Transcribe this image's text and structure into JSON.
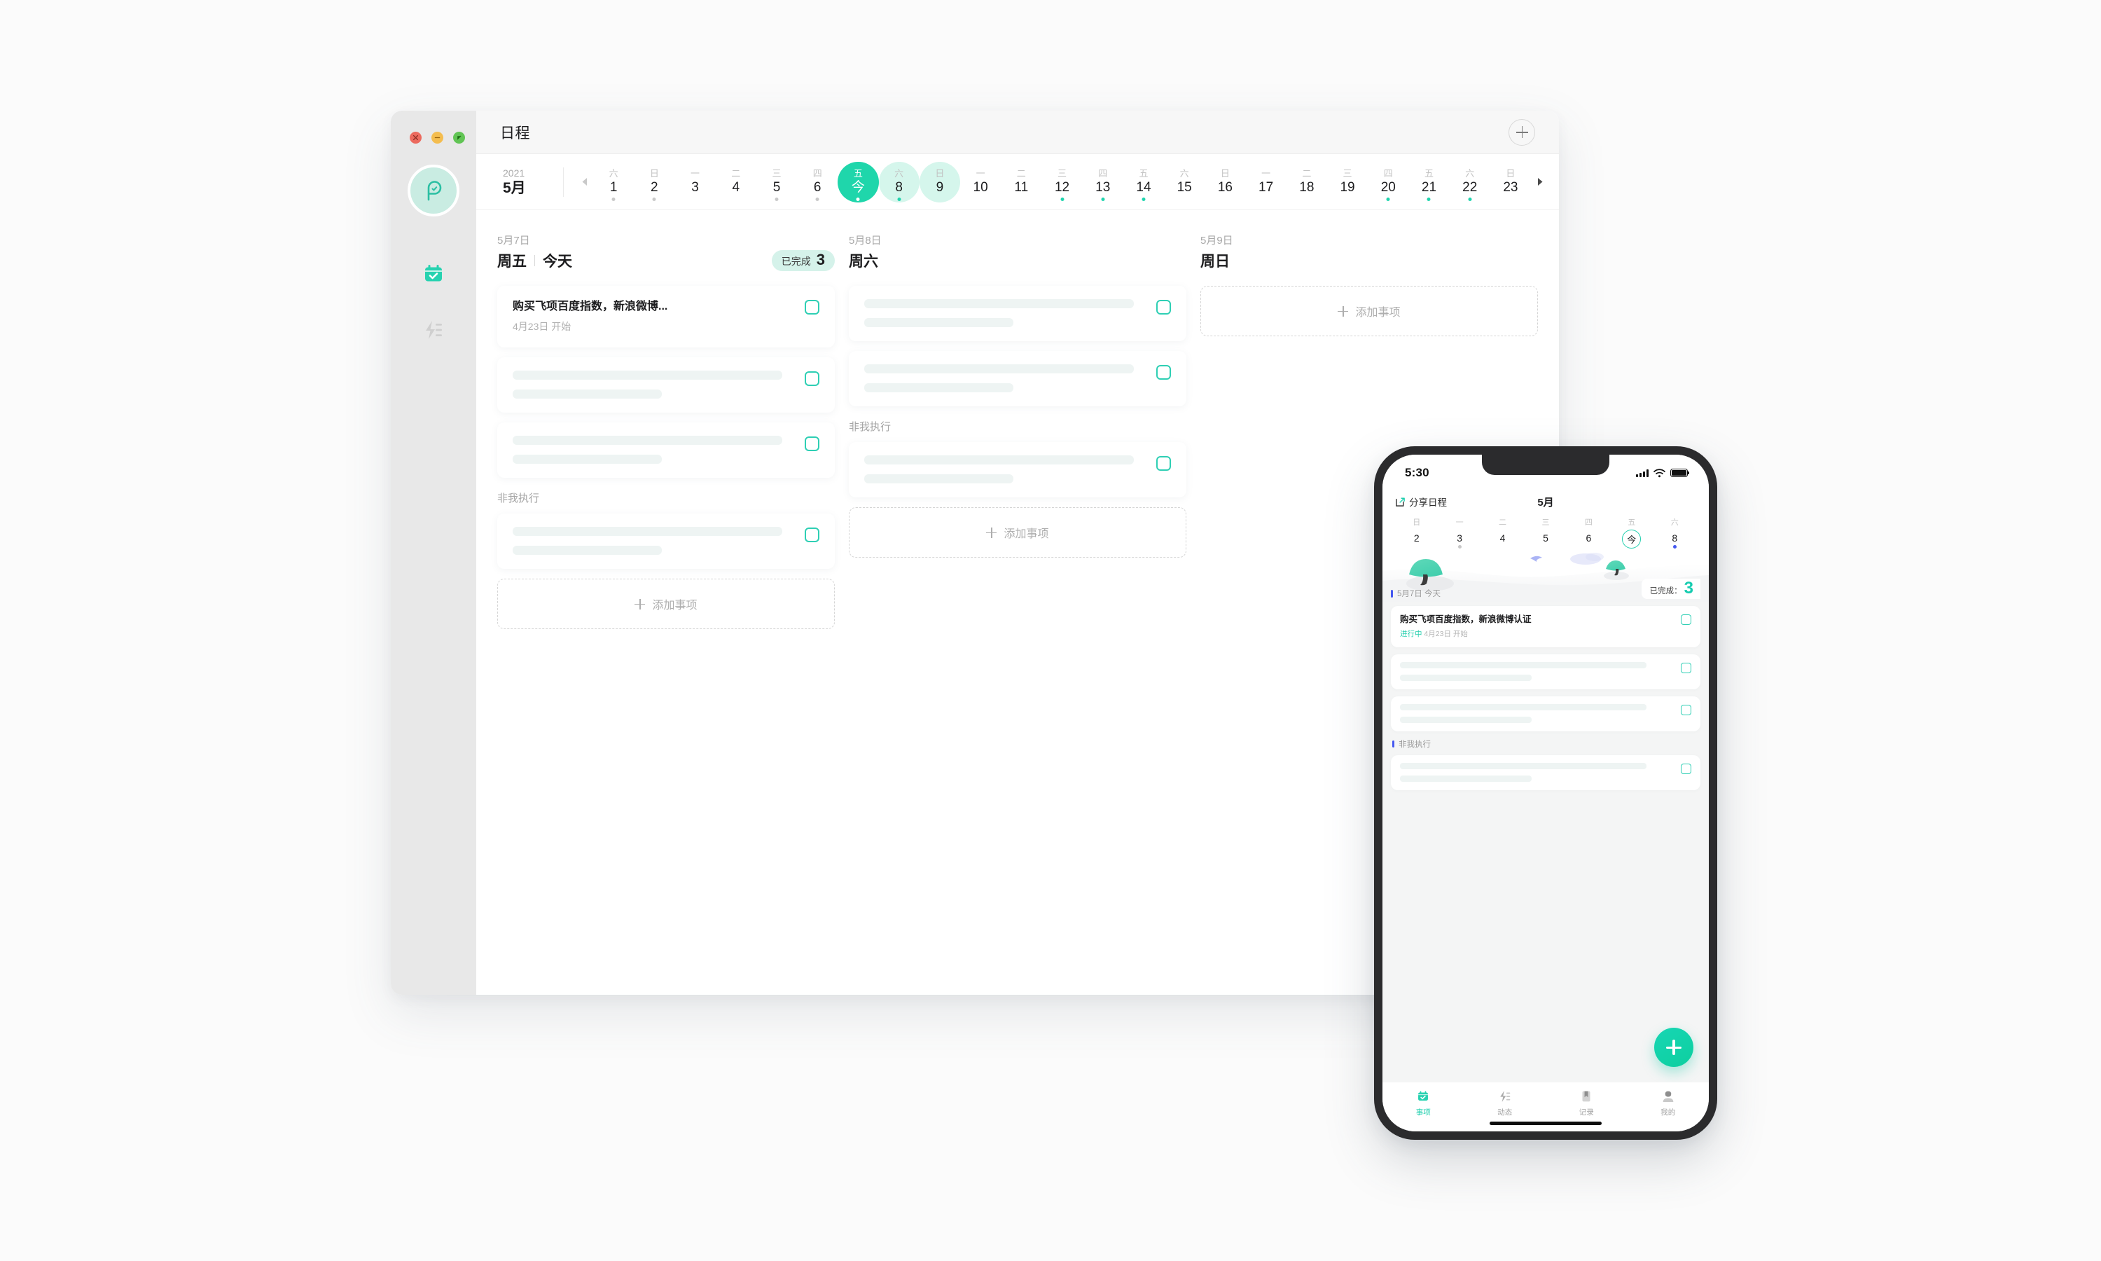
{
  "desktop": {
    "window_title": "日程",
    "titlebar": {
      "add_button_icon": "plus-circle-icon"
    },
    "traffic_lights": [
      "close",
      "minimize",
      "maximize"
    ],
    "sidebar": {
      "avatar_icon": "app-logo-icon",
      "items": [
        {
          "name": "schedule",
          "icon": "calendar-check-icon",
          "active": true
        },
        {
          "name": "activity",
          "icon": "activity-lightning-icon",
          "active": false
        }
      ]
    },
    "datestrip": {
      "year": "2021",
      "month": "5月",
      "prev_icon": "chevron-left-icon",
      "next_icon": "chevron-right-icon",
      "days": [
        {
          "weekday": "六",
          "num": "1",
          "dot": "grey",
          "state": "normal"
        },
        {
          "weekday": "日",
          "num": "2",
          "dot": "grey",
          "state": "normal"
        },
        {
          "weekday": "一",
          "num": "3",
          "dot": "none",
          "state": "normal"
        },
        {
          "weekday": "二",
          "num": "4",
          "dot": "none",
          "state": "normal"
        },
        {
          "weekday": "三",
          "num": "5",
          "dot": "grey",
          "state": "normal"
        },
        {
          "weekday": "四",
          "num": "6",
          "dot": "grey",
          "state": "normal"
        },
        {
          "weekday": "五",
          "num": "今",
          "dot": "white",
          "state": "today"
        },
        {
          "weekday": "六",
          "num": "8",
          "dot": "teal",
          "state": "highlight"
        },
        {
          "weekday": "日",
          "num": "9",
          "dot": "none",
          "state": "highlight"
        },
        {
          "weekday": "一",
          "num": "10",
          "dot": "none",
          "state": "normal"
        },
        {
          "weekday": "二",
          "num": "11",
          "dot": "none",
          "state": "normal"
        },
        {
          "weekday": "三",
          "num": "12",
          "dot": "teal",
          "state": "normal"
        },
        {
          "weekday": "四",
          "num": "13",
          "dot": "teal",
          "state": "normal"
        },
        {
          "weekday": "五",
          "num": "14",
          "dot": "teal",
          "state": "normal"
        },
        {
          "weekday": "六",
          "num": "15",
          "dot": "none",
          "state": "normal"
        },
        {
          "weekday": "日",
          "num": "16",
          "dot": "none",
          "state": "normal"
        },
        {
          "weekday": "一",
          "num": "17",
          "dot": "none",
          "state": "normal"
        },
        {
          "weekday": "二",
          "num": "18",
          "dot": "none",
          "state": "normal"
        },
        {
          "weekday": "三",
          "num": "19",
          "dot": "none",
          "state": "normal"
        },
        {
          "weekday": "四",
          "num": "20",
          "dot": "teal",
          "state": "normal"
        },
        {
          "weekday": "五",
          "num": "21",
          "dot": "teal",
          "state": "normal"
        },
        {
          "weekday": "六",
          "num": "22",
          "dot": "teal",
          "state": "normal"
        },
        {
          "weekday": "日",
          "num": "23",
          "dot": "none",
          "state": "normal"
        }
      ]
    },
    "columns": [
      {
        "date": "5月7日",
        "weekday": "周五",
        "today_label": "今天",
        "done_label": "已完成",
        "done_count": "3",
        "tasks": [
          {
            "kind": "text",
            "title": "购买飞项百度指数，新浪微博...",
            "sub": "4月23日 开始"
          },
          {
            "kind": "skeleton"
          },
          {
            "kind": "skeleton"
          }
        ],
        "section_label": "非我执行",
        "section_tasks": [
          {
            "kind": "skeleton"
          }
        ],
        "add_label": "添加事项"
      },
      {
        "date": "5月8日",
        "weekday": "周六",
        "tasks": [
          {
            "kind": "skeleton"
          },
          {
            "kind": "skeleton"
          }
        ],
        "section_label": "非我执行",
        "section_tasks": [
          {
            "kind": "skeleton"
          }
        ],
        "add_label": "添加事项"
      },
      {
        "date": "5月9日",
        "weekday": "周日",
        "tasks": [],
        "add_label": "添加事项"
      }
    ]
  },
  "phone": {
    "statusbar": {
      "time": "5:30",
      "signal_icon": "cellular-signal-icon",
      "wifi_icon": "wifi-icon",
      "battery_icon": "battery-icon"
    },
    "header": {
      "share_icon": "share-calendar-icon",
      "share_label": "分享日程",
      "month": "5月"
    },
    "week": [
      {
        "weekday": "日",
        "num": "2",
        "dot": "none",
        "today": false
      },
      {
        "weekday": "一",
        "num": "3",
        "dot": "grey",
        "today": false
      },
      {
        "weekday": "二",
        "num": "4",
        "dot": "none",
        "today": false
      },
      {
        "weekday": "三",
        "num": "5",
        "dot": "none",
        "today": false
      },
      {
        "weekday": "四",
        "num": "6",
        "dot": "none",
        "today": false
      },
      {
        "weekday": "五",
        "num": "今",
        "dot": "none",
        "today": true
      },
      {
        "weekday": "六",
        "num": "8",
        "dot": "blue",
        "today": false
      }
    ],
    "hero": {
      "date_label": "5月7日 今天",
      "done_label": "已完成：",
      "done_count": "3",
      "illustration": "tree-landscape-illustration"
    },
    "tasks": [
      {
        "kind": "text",
        "title": "购买飞项百度指数，新浪微博认证",
        "status": "进行中",
        "sub": "4月23日 开始"
      },
      {
        "kind": "skeleton"
      },
      {
        "kind": "skeleton"
      }
    ],
    "section_label": "非我执行",
    "section_tasks": [
      {
        "kind": "skeleton"
      }
    ],
    "fab_icon": "plus-icon",
    "tabbar": [
      {
        "label": "事项",
        "icon": "calendar-check-icon",
        "active": true
      },
      {
        "label": "动态",
        "icon": "activity-lightning-icon",
        "active": false
      },
      {
        "label": "记录",
        "icon": "bookmark-icon",
        "active": false
      },
      {
        "label": "我的",
        "icon": "person-icon",
        "active": false
      }
    ]
  },
  "colors": {
    "accent": "#1fd6ab",
    "accent_light": "#d5f6ec",
    "skeleton": "#eef4f3",
    "blue_marker": "#4558f0"
  }
}
